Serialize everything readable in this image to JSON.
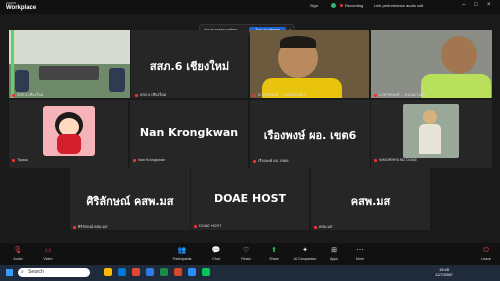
{
  "app": {
    "name_top": "zoom",
    "name": "Workplace"
  },
  "titlebar": {
    "sign": "Sign",
    "recording": "Recording",
    "perf": "Link performance audio soft"
  },
  "notice": {
    "text": "You're seeing gallery",
    "button": "Turn on reframe"
  },
  "tiles": [
    {
      "name": "สสภ.6 เชียงใหม่",
      "big": "สสภ.6 เชียงใหม่"
    },
    {
      "name": "นายวัชรพงษ์ ... หน่วยงานที่ 1",
      "big": ""
    },
    {
      "name": "Tipasu",
      "big": ""
    },
    {
      "name": "Nan Krongkwan",
      "big": "Nan Krongkwan"
    },
    {
      "name": "เรืองพงษ์ ผอ. เขต6",
      "big": "เรืองพงษ์ ผอ. เขต6"
    },
    {
      "name": "WMORHFA ND DOAE",
      "big": ""
    },
    {
      "name": "ศิริลักษณ์ คสพ.มส",
      "big": "ศิริลักษณ์ คสพ.มส"
    },
    {
      "name": "DOAE HOST",
      "big": "DOAE HOST"
    },
    {
      "name": "คสพ.มส",
      "big": "คสพ.มส"
    }
  ],
  "toolbar": {
    "audio": "Audio",
    "video": "Video",
    "participants": "Participants",
    "chat": "Chat",
    "react": "React",
    "share": "Share",
    "ai": "AI Companion",
    "apps": "Apps",
    "more": "More",
    "leave": "Leave",
    "participants_count": "54"
  },
  "taskbar": {
    "search": "Search",
    "time": "15:45",
    "date": "12/7/2567"
  },
  "colors": {
    "share": "#22c55e",
    "leave": "#e5484d",
    "accent": "#1f62d8"
  }
}
